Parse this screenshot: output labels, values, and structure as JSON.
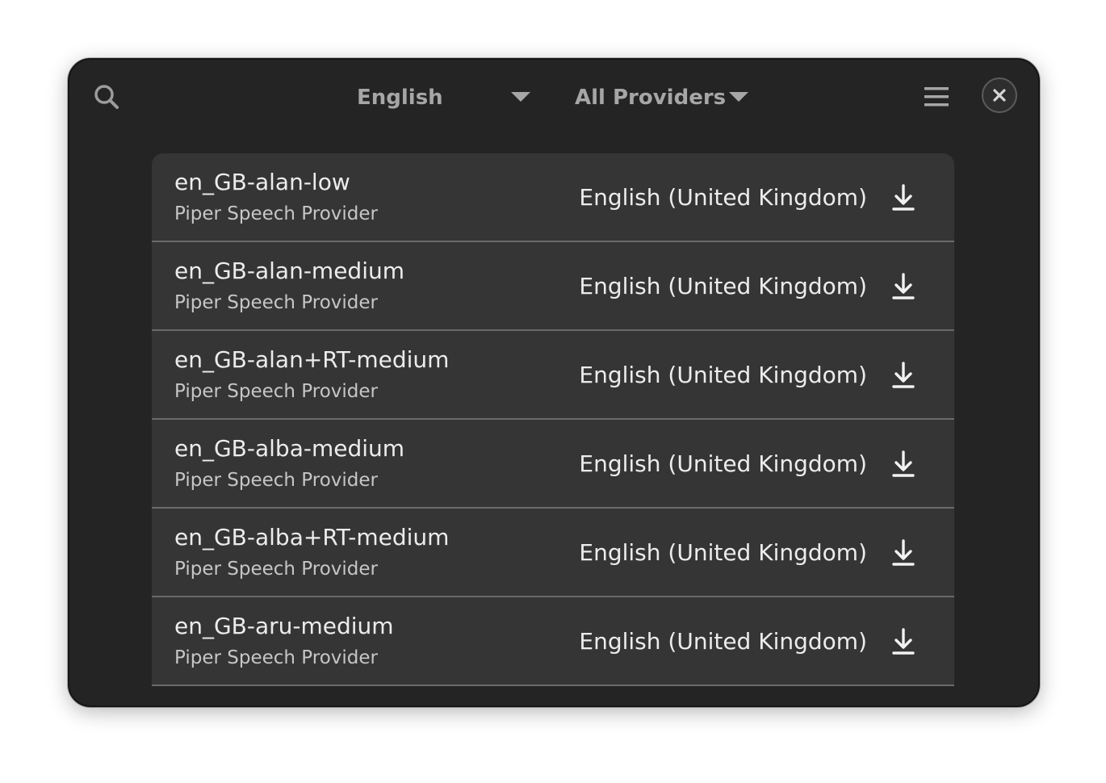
{
  "header": {
    "search_icon": "search-icon",
    "language_filter": {
      "selected": "English",
      "icon": "chevron-down-icon"
    },
    "provider_filter": {
      "selected": "All Providers",
      "icon": "chevron-down-icon"
    },
    "menu_icon": "hamburger-menu-icon",
    "close_icon": "close-icon"
  },
  "voices": [
    {
      "name": "en_GB-alan-low",
      "provider": "Piper Speech Provider",
      "language": "English (United Kingdom)",
      "action_icon": "download-icon"
    },
    {
      "name": "en_GB-alan-medium",
      "provider": "Piper Speech Provider",
      "language": "English (United Kingdom)",
      "action_icon": "download-icon"
    },
    {
      "name": "en_GB-alan+RT-medium",
      "provider": "Piper Speech Provider",
      "language": "English (United Kingdom)",
      "action_icon": "download-icon"
    },
    {
      "name": "en_GB-alba-medium",
      "provider": "Piper Speech Provider",
      "language": "English (United Kingdom)",
      "action_icon": "download-icon"
    },
    {
      "name": "en_GB-alba+RT-medium",
      "provider": "Piper Speech Provider",
      "language": "English (United Kingdom)",
      "action_icon": "download-icon"
    },
    {
      "name": "en_GB-aru-medium",
      "provider": "Piper Speech Provider",
      "language": "English (United Kingdom)",
      "action_icon": "download-icon"
    }
  ],
  "colors": {
    "window_bg": "#242424",
    "list_bg": "#353535",
    "separator": "#6a6a6a",
    "primary_text": "#ececec",
    "secondary_text": "#c6c6c6",
    "header_text": "#a6a6a6"
  }
}
